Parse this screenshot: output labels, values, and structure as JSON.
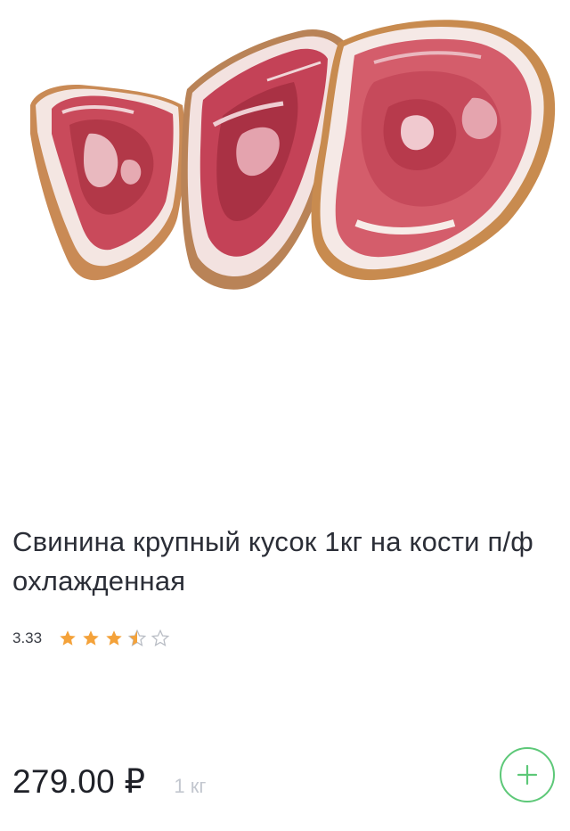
{
  "product": {
    "image_icon": "pork-meat-image",
    "title": "Свинина крупный кусок 1кг на кости п/ф охлажденная",
    "rating": {
      "value_label": "3.33",
      "value": 3.33,
      "max": 5,
      "star_color": "#f4a23a",
      "empty_star_color": "#b8bcc4"
    },
    "price_label": "279.00 ₽",
    "unit_label": "1 кг",
    "add_button_icon": "plus-icon",
    "accent_color": "#5dc878"
  }
}
